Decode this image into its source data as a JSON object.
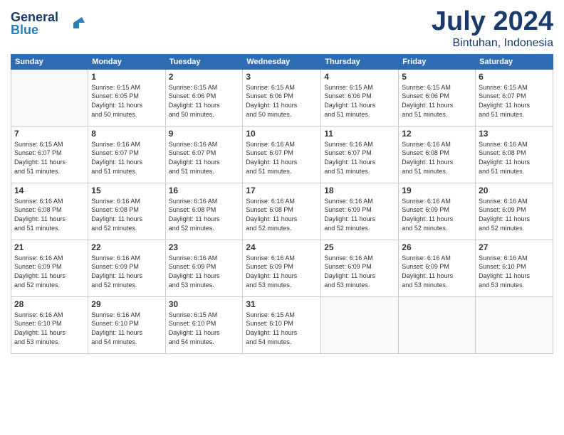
{
  "header": {
    "logo_line1": "General",
    "logo_line2": "Blue",
    "month": "July 2024",
    "location": "Bintuhan, Indonesia"
  },
  "weekdays": [
    "Sunday",
    "Monday",
    "Tuesday",
    "Wednesday",
    "Thursday",
    "Friday",
    "Saturday"
  ],
  "weeks": [
    [
      {
        "day": "",
        "info": ""
      },
      {
        "day": "1",
        "info": "Sunrise: 6:15 AM\nSunset: 6:05 PM\nDaylight: 11 hours\nand 50 minutes."
      },
      {
        "day": "2",
        "info": "Sunrise: 6:15 AM\nSunset: 6:06 PM\nDaylight: 11 hours\nand 50 minutes."
      },
      {
        "day": "3",
        "info": "Sunrise: 6:15 AM\nSunset: 6:06 PM\nDaylight: 11 hours\nand 50 minutes."
      },
      {
        "day": "4",
        "info": "Sunrise: 6:15 AM\nSunset: 6:06 PM\nDaylight: 11 hours\nand 51 minutes."
      },
      {
        "day": "5",
        "info": "Sunrise: 6:15 AM\nSunset: 6:06 PM\nDaylight: 11 hours\nand 51 minutes."
      },
      {
        "day": "6",
        "info": "Sunrise: 6:15 AM\nSunset: 6:07 PM\nDaylight: 11 hours\nand 51 minutes."
      }
    ],
    [
      {
        "day": "7",
        "info": "Sunrise: 6:15 AM\nSunset: 6:07 PM\nDaylight: 11 hours\nand 51 minutes."
      },
      {
        "day": "8",
        "info": "Sunrise: 6:16 AM\nSunset: 6:07 PM\nDaylight: 11 hours\nand 51 minutes."
      },
      {
        "day": "9",
        "info": "Sunrise: 6:16 AM\nSunset: 6:07 PM\nDaylight: 11 hours\nand 51 minutes."
      },
      {
        "day": "10",
        "info": "Sunrise: 6:16 AM\nSunset: 6:07 PM\nDaylight: 11 hours\nand 51 minutes."
      },
      {
        "day": "11",
        "info": "Sunrise: 6:16 AM\nSunset: 6:07 PM\nDaylight: 11 hours\nand 51 minutes."
      },
      {
        "day": "12",
        "info": "Sunrise: 6:16 AM\nSunset: 6:08 PM\nDaylight: 11 hours\nand 51 minutes."
      },
      {
        "day": "13",
        "info": "Sunrise: 6:16 AM\nSunset: 6:08 PM\nDaylight: 11 hours\nand 51 minutes."
      }
    ],
    [
      {
        "day": "14",
        "info": "Sunrise: 6:16 AM\nSunset: 6:08 PM\nDaylight: 11 hours\nand 51 minutes."
      },
      {
        "day": "15",
        "info": "Sunrise: 6:16 AM\nSunset: 6:08 PM\nDaylight: 11 hours\nand 52 minutes."
      },
      {
        "day": "16",
        "info": "Sunrise: 6:16 AM\nSunset: 6:08 PM\nDaylight: 11 hours\nand 52 minutes."
      },
      {
        "day": "17",
        "info": "Sunrise: 6:16 AM\nSunset: 6:08 PM\nDaylight: 11 hours\nand 52 minutes."
      },
      {
        "day": "18",
        "info": "Sunrise: 6:16 AM\nSunset: 6:09 PM\nDaylight: 11 hours\nand 52 minutes."
      },
      {
        "day": "19",
        "info": "Sunrise: 6:16 AM\nSunset: 6:09 PM\nDaylight: 11 hours\nand 52 minutes."
      },
      {
        "day": "20",
        "info": "Sunrise: 6:16 AM\nSunset: 6:09 PM\nDaylight: 11 hours\nand 52 minutes."
      }
    ],
    [
      {
        "day": "21",
        "info": "Sunrise: 6:16 AM\nSunset: 6:09 PM\nDaylight: 11 hours\nand 52 minutes."
      },
      {
        "day": "22",
        "info": "Sunrise: 6:16 AM\nSunset: 6:09 PM\nDaylight: 11 hours\nand 52 minutes."
      },
      {
        "day": "23",
        "info": "Sunrise: 6:16 AM\nSunset: 6:09 PM\nDaylight: 11 hours\nand 53 minutes."
      },
      {
        "day": "24",
        "info": "Sunrise: 6:16 AM\nSunset: 6:09 PM\nDaylight: 11 hours\nand 53 minutes."
      },
      {
        "day": "25",
        "info": "Sunrise: 6:16 AM\nSunset: 6:09 PM\nDaylight: 11 hours\nand 53 minutes."
      },
      {
        "day": "26",
        "info": "Sunrise: 6:16 AM\nSunset: 6:09 PM\nDaylight: 11 hours\nand 53 minutes."
      },
      {
        "day": "27",
        "info": "Sunrise: 6:16 AM\nSunset: 6:10 PM\nDaylight: 11 hours\nand 53 minutes."
      }
    ],
    [
      {
        "day": "28",
        "info": "Sunrise: 6:16 AM\nSunset: 6:10 PM\nDaylight: 11 hours\nand 53 minutes."
      },
      {
        "day": "29",
        "info": "Sunrise: 6:16 AM\nSunset: 6:10 PM\nDaylight: 11 hours\nand 54 minutes."
      },
      {
        "day": "30",
        "info": "Sunrise: 6:15 AM\nSunset: 6:10 PM\nDaylight: 11 hours\nand 54 minutes."
      },
      {
        "day": "31",
        "info": "Sunrise: 6:15 AM\nSunset: 6:10 PM\nDaylight: 11 hours\nand 54 minutes."
      },
      {
        "day": "",
        "info": ""
      },
      {
        "day": "",
        "info": ""
      },
      {
        "day": "",
        "info": ""
      }
    ]
  ]
}
